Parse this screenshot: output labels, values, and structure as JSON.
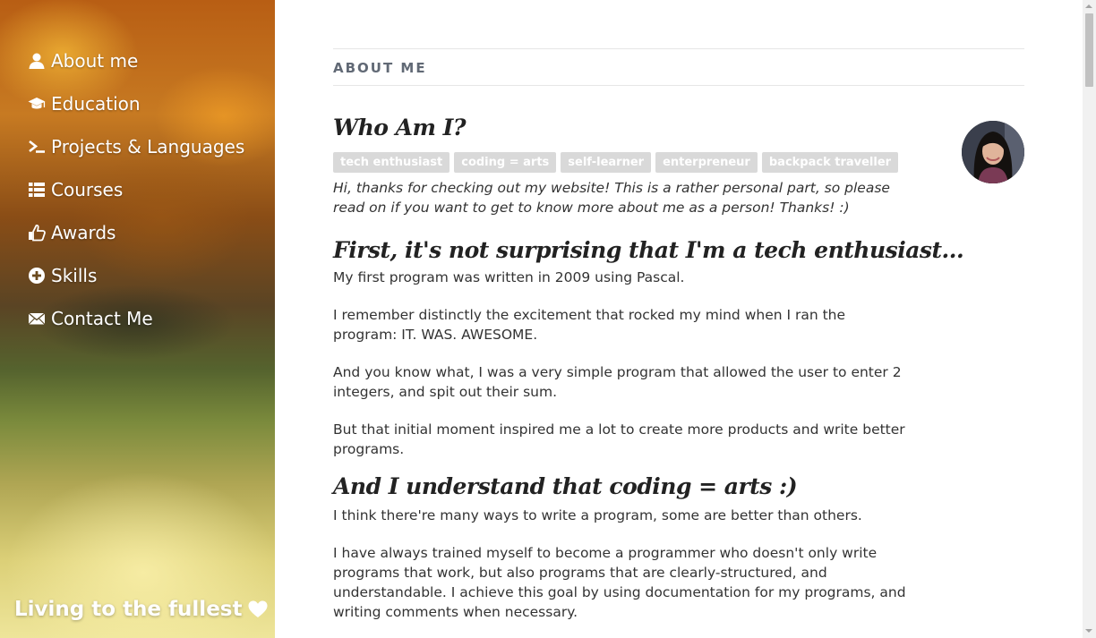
{
  "nav": {
    "items": [
      {
        "label": "About me",
        "icon": "user-icon"
      },
      {
        "label": "Education",
        "icon": "graduation-cap-icon"
      },
      {
        "label": "Projects & Languages",
        "icon": "terminal-icon"
      },
      {
        "label": "Courses",
        "icon": "list-icon"
      },
      {
        "label": "Awards",
        "icon": "thumbs-up-icon"
      },
      {
        "label": "Skills",
        "icon": "plus-circle-icon"
      },
      {
        "label": "Contact Me",
        "icon": "envelope-icon"
      }
    ]
  },
  "sidebar_footer": {
    "text": "Living to the fullest",
    "icon": "heart-icon"
  },
  "main": {
    "section_title": "ABOUT ME",
    "heading1": "Who Am I?",
    "tags": [
      "tech enthusiast",
      "coding = arts",
      "self-learner",
      "enterpreneur",
      "backpack traveller"
    ],
    "intro": "Hi, thanks for checking out my website! This is a rather personal part, so please read on if you want to get to know more about me as a person! Thanks! :)",
    "heading2": "First, it's not surprising that I'm a tech enthusiast...",
    "p1": "My first program was written in 2009 using Pascal.",
    "p2": "I remember distinctly the excitement that rocked my mind when I ran the program: IT. WAS. AWESOME.",
    "p3": "And you know what, I was a very simple program that allowed the user to enter 2 integers, and spit out their sum.",
    "p4": "But that initial moment inspired me a lot to create more products and write better programs.",
    "heading3": "And I understand that coding = arts :)",
    "p5": "I think there're many ways to write a program, some are better than others.",
    "p6": "I have always trained myself to become a programmer who doesn't only write programs that work, but also programs that are clearly-structured, and understandable. I achieve this goal by using documentation for my programs, and writing comments when necessary."
  },
  "colors": {
    "tag_bg": "#d9d9d9",
    "section_title": "#616975",
    "text": "#333333"
  }
}
